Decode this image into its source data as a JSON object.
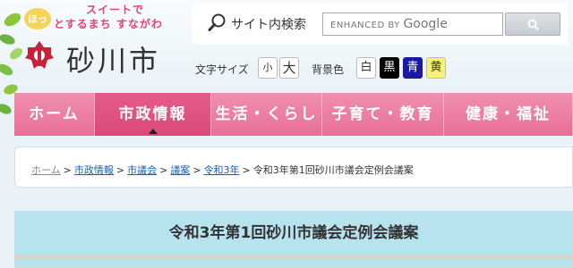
{
  "header": {
    "tagline_badge": "ほっ",
    "tagline_top": "スイートで",
    "tagline_bottom": "とするまち すながわ",
    "city_name": "砂川市",
    "brand_color": "#e8407a"
  },
  "search": {
    "label": "サイト内検索",
    "placeholder_prefix": "ENHANCED BY",
    "placeholder_brand": "Google",
    "button_icon": "search-icon"
  },
  "text_size": {
    "label": "文字サイズ",
    "small": "小",
    "large": "大"
  },
  "background_color": {
    "label": "背景色",
    "white": "白",
    "black": "黒",
    "blue": "青",
    "yellow": "黄"
  },
  "nav": {
    "items": [
      {
        "label": "ホーム",
        "active": false
      },
      {
        "label": "市政情報",
        "active": true
      },
      {
        "label": "生活・くらし",
        "active": false
      },
      {
        "label": "子育て・教育",
        "active": false
      },
      {
        "label": "健康・福祉",
        "active": false
      }
    ],
    "accent": "#e86e98"
  },
  "breadcrumb": {
    "items": [
      "ホーム",
      "市政情報",
      "市議会",
      "議案",
      "令和3年"
    ],
    "separator": ">",
    "current": "令和3年第1回砂川市議会定例会議案"
  },
  "page": {
    "title": "令和3年第1回砂川市議会定例会議案"
  }
}
